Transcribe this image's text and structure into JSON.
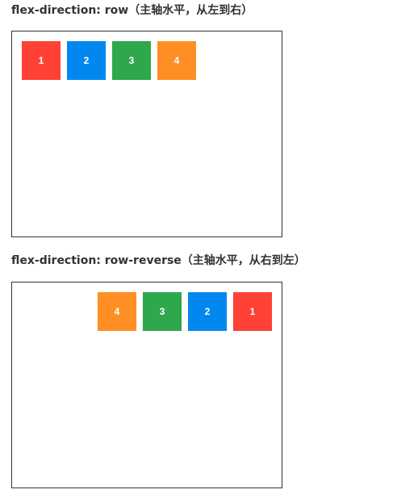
{
  "sections": [
    {
      "title": "flex-direction: row（主轴水平，从左到右）",
      "direction": "row",
      "items": [
        {
          "label": "1",
          "color": "#FF4136"
        },
        {
          "label": "2",
          "color": "#0088F0"
        },
        {
          "label": "3",
          "color": "#2EA84A"
        },
        {
          "label": "4",
          "color": "#FF8F24"
        }
      ]
    },
    {
      "title": "flex-direction: row-reverse（主轴水平，从右到左）",
      "direction": "row-reverse",
      "items": [
        {
          "label": "1",
          "color": "#FF4136"
        },
        {
          "label": "2",
          "color": "#0088F0"
        },
        {
          "label": "3",
          "color": "#2EA84A"
        },
        {
          "label": "4",
          "color": "#FF8F24"
        }
      ]
    }
  ]
}
